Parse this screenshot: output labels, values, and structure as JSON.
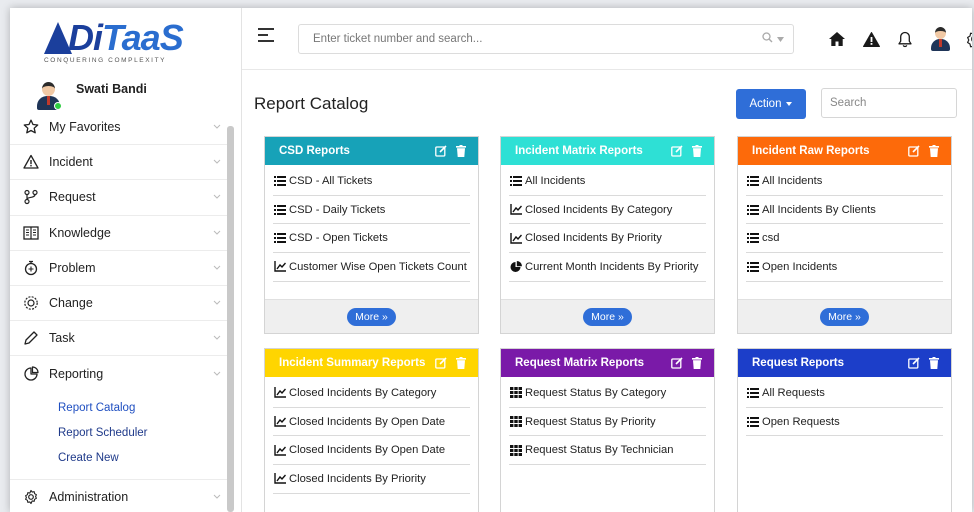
{
  "colors": {
    "csd": "#17a2b8",
    "incident_matrix": "#2ee0d5",
    "incident_raw": "#fd6a0a",
    "incident_summary": "#ffd500",
    "request_matrix": "#7a1aa8",
    "request_reports": "#1c3ec9",
    "primary": "#2f6ed8"
  },
  "logo": {
    "main_di": "Di",
    "main_taas": "TaaS",
    "tagline": "CONQUERING COMPLEXITY"
  },
  "user": {
    "name": "Swati Bandi"
  },
  "sidebar": {
    "items": [
      {
        "label": "My Favorites",
        "icon": "star-icon"
      },
      {
        "label": "Incident",
        "icon": "warning-icon"
      },
      {
        "label": "Request",
        "icon": "request-icon"
      },
      {
        "label": "Knowledge",
        "icon": "book-icon"
      },
      {
        "label": "Problem",
        "icon": "problem-icon"
      },
      {
        "label": "Change",
        "icon": "change-icon"
      },
      {
        "label": "Task",
        "icon": "pencil-icon"
      },
      {
        "label": "Reporting",
        "icon": "reporting-icon"
      }
    ],
    "reporting_sub": [
      {
        "label": "Report Catalog"
      },
      {
        "label": "Report Scheduler"
      },
      {
        "label": "Create New"
      }
    ],
    "admin": {
      "label": "Administration",
      "icon": "cog-icon"
    }
  },
  "topbar": {
    "search_placeholder": "Enter ticket number and search..."
  },
  "content": {
    "title": "Report Catalog",
    "action_label": "Action",
    "search_placeholder": "Search",
    "more_label": "More »"
  },
  "cards": [
    {
      "title": "CSD Reports",
      "color_key": "csd",
      "rows": [
        {
          "label": "CSD - All Tickets",
          "icon": "list-icon"
        },
        {
          "label": "CSD - Daily Tickets",
          "icon": "list-icon"
        },
        {
          "label": "CSD - Open Tickets",
          "icon": "list-icon"
        },
        {
          "label": "Customer Wise Open Tickets Count",
          "icon": "line-chart-icon"
        }
      ]
    },
    {
      "title": "Incident Matrix Reports",
      "color_key": "incident_matrix",
      "rows": [
        {
          "label": "All Incidents",
          "icon": "list-icon"
        },
        {
          "label": "Closed Incidents By Category",
          "icon": "line-chart-icon"
        },
        {
          "label": "Closed Incidents By Priority",
          "icon": "line-chart-icon"
        },
        {
          "label": "Current Month Incidents By Priority",
          "icon": "pie-chart-icon"
        }
      ]
    },
    {
      "title": "Incident Raw Reports",
      "color_key": "incident_raw",
      "rows": [
        {
          "label": "All Incidents",
          "icon": "list-icon"
        },
        {
          "label": "All Incidents By Clients",
          "icon": "list-icon"
        },
        {
          "label": "csd",
          "icon": "list-icon"
        },
        {
          "label": "Open Incidents",
          "icon": "list-icon"
        }
      ]
    },
    {
      "title": "Incident Summary Reports",
      "color_key": "incident_summary",
      "rows": [
        {
          "label": "Closed Incidents By Category",
          "icon": "line-chart-icon"
        },
        {
          "label": "Closed Incidents By Open Date",
          "icon": "line-chart-icon"
        },
        {
          "label": "Closed Incidents By Open Date",
          "icon": "line-chart-icon"
        },
        {
          "label": "Closed Incidents By Priority",
          "icon": "line-chart-icon"
        }
      ]
    },
    {
      "title": "Request Matrix Reports",
      "color_key": "request_matrix",
      "rows": [
        {
          "label": "Request Status By Category",
          "icon": "grid-icon"
        },
        {
          "label": "Request Status By Priority",
          "icon": "grid-icon"
        },
        {
          "label": "Request Status By Technician",
          "icon": "grid-icon"
        }
      ]
    },
    {
      "title": "Request Reports",
      "color_key": "request_reports",
      "rows": [
        {
          "label": "All Requests",
          "icon": "list-icon"
        },
        {
          "label": "Open Requests",
          "icon": "list-icon"
        }
      ]
    }
  ]
}
